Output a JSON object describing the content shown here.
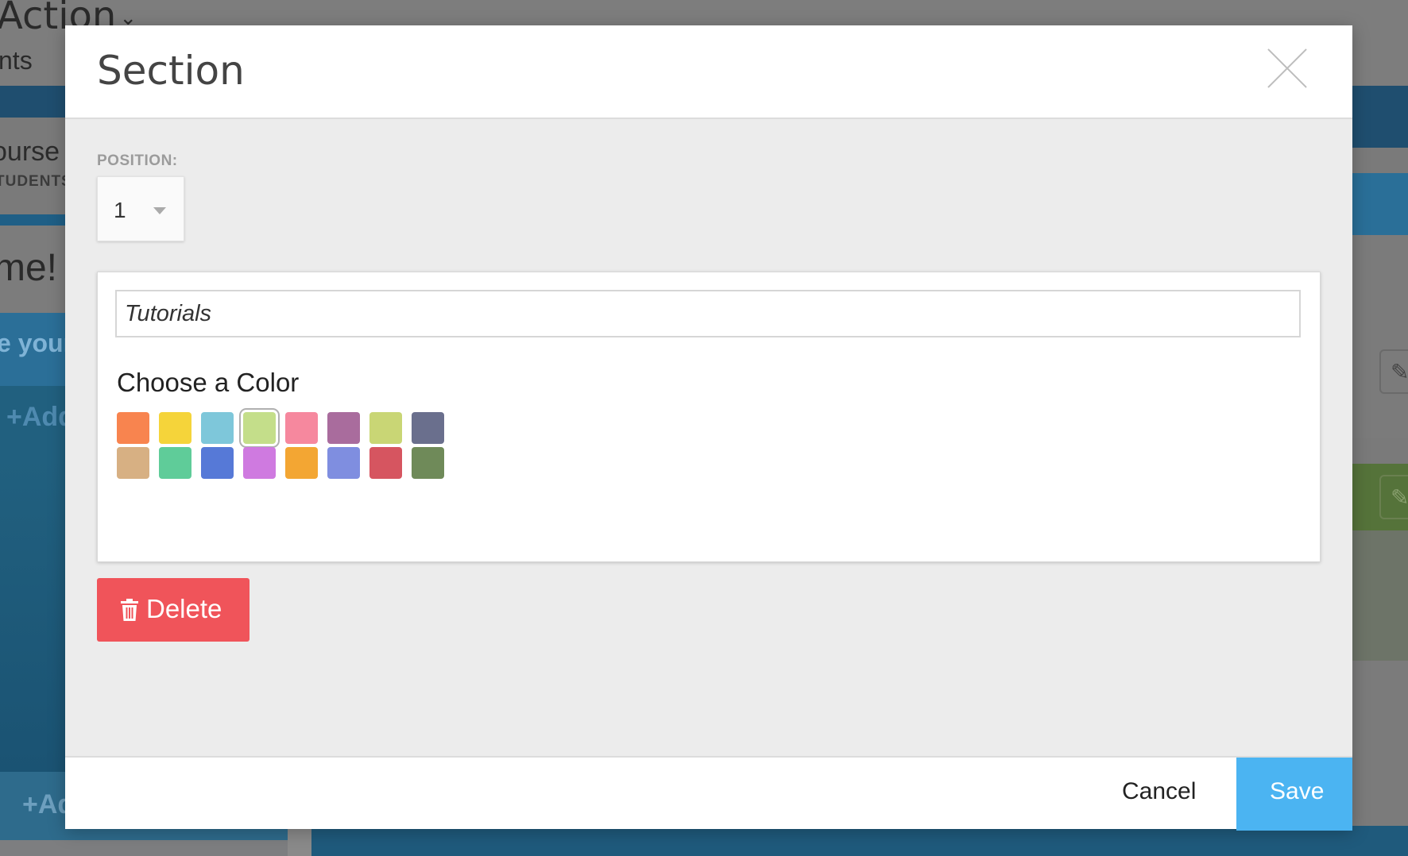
{
  "background": {
    "title": "Action",
    "subtitle": "nts",
    "course": "ourse l",
    "students": "TUDENTS",
    "welcome": "me!",
    "your": "e your",
    "add1": "+Add",
    "add2": "+Ad"
  },
  "modal": {
    "title": "Section",
    "position": {
      "label": "POSITION:",
      "value": "1"
    },
    "name_input": {
      "value": "Tutorials"
    },
    "choose_color_label": "Choose a Color",
    "colors": [
      {
        "hex": "#f8844f",
        "row": 0,
        "col": 0,
        "selected": false
      },
      {
        "hex": "#f5d43a",
        "row": 0,
        "col": 1,
        "selected": false
      },
      {
        "hex": "#7ec7da",
        "row": 0,
        "col": 2,
        "selected": false
      },
      {
        "hex": "#c4de8a",
        "row": 0,
        "col": 3,
        "selected": true
      },
      {
        "hex": "#f6889e",
        "row": 0,
        "col": 4,
        "selected": false
      },
      {
        "hex": "#a96c9d",
        "row": 0,
        "col": 5,
        "selected": false
      },
      {
        "hex": "#c9d675",
        "row": 0,
        "col": 6,
        "selected": false
      },
      {
        "hex": "#6a6f8d",
        "row": 0,
        "col": 7,
        "selected": false
      },
      {
        "hex": "#d7b083",
        "row": 1,
        "col": 0,
        "selected": false
      },
      {
        "hex": "#5fcc99",
        "row": 1,
        "col": 1,
        "selected": false
      },
      {
        "hex": "#5679d7",
        "row": 1,
        "col": 2,
        "selected": false
      },
      {
        "hex": "#cf7ae0",
        "row": 1,
        "col": 3,
        "selected": false
      },
      {
        "hex": "#f3a633",
        "row": 1,
        "col": 4,
        "selected": false
      },
      {
        "hex": "#7f8ee0",
        "row": 1,
        "col": 5,
        "selected": false
      },
      {
        "hex": "#d65560",
        "row": 1,
        "col": 6,
        "selected": false
      },
      {
        "hex": "#6f8a59",
        "row": 1,
        "col": 7,
        "selected": false
      }
    ],
    "delete_label": "Delete",
    "cancel_label": "Cancel",
    "save_label": "Save",
    "accent_colors": {
      "delete": "#f0545a",
      "save": "#4bb4f2"
    },
    "icons": {
      "close": "close-icon",
      "delete": "trash-icon",
      "position": "caret-down-icon"
    }
  }
}
